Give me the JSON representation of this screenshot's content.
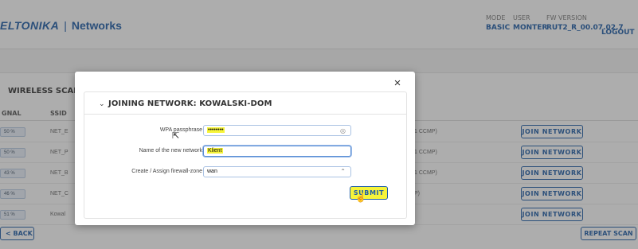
{
  "header": {
    "brand_logo": "ELTONIKA",
    "brand_sep": "|",
    "brand_title": "Networks",
    "mode_label": "MODE",
    "mode_value": "BASIC",
    "user_label": "USER",
    "user_value": "MONTER",
    "fw_label": "FW VERSION",
    "fw_value": "RUT2_R_00.07.02.7",
    "logout": "LOGOUT"
  },
  "page": {
    "section_title": "WIRELESS SCAN RES",
    "col_signal": "GNAL",
    "col_ssid": "SSID",
    "rows": [
      {
        "signal": "50 %",
        "ssid": "NET_E",
        "enc": "1 CCMP)",
        "action": "JOIN NETWORK"
      },
      {
        "signal": "50 %",
        "ssid": "NET_P",
        "enc": "1 CCMP)",
        "action": "JOIN NETWORK"
      },
      {
        "signal": "43 %",
        "ssid": "NET_B",
        "enc": "1 CCMP)",
        "action": "JOIN NETWORK"
      },
      {
        "signal": "46 %",
        "ssid": "NET_C",
        "enc": "P)",
        "action": "JOIN NETWORK"
      },
      {
        "signal": "51 %",
        "ssid": "Kowal",
        "enc": "",
        "action": "JOIN NETWORK"
      }
    ],
    "back": "< BACK",
    "repeat": "REPEAT SCAN"
  },
  "modal": {
    "close": "×",
    "title": "JOINING NETWORK: KOWALSKI-DOM",
    "wpa_label": "WPA passphrase",
    "wpa_value": "••••••••",
    "name_label": "Name of the new network",
    "name_value": "Klient",
    "zone_label": "Create / Assign firewall-zone",
    "zone_value": "wan",
    "submit": "SUBMIT"
  },
  "colors": {
    "accent": "#1f5ea8",
    "highlight": "#f6f43a"
  },
  "icons": [
    "close-icon",
    "chevron-down-icon",
    "eye-icon",
    "chevron-up-icon",
    "cursor-icon",
    "hand-pointer-icon"
  ]
}
